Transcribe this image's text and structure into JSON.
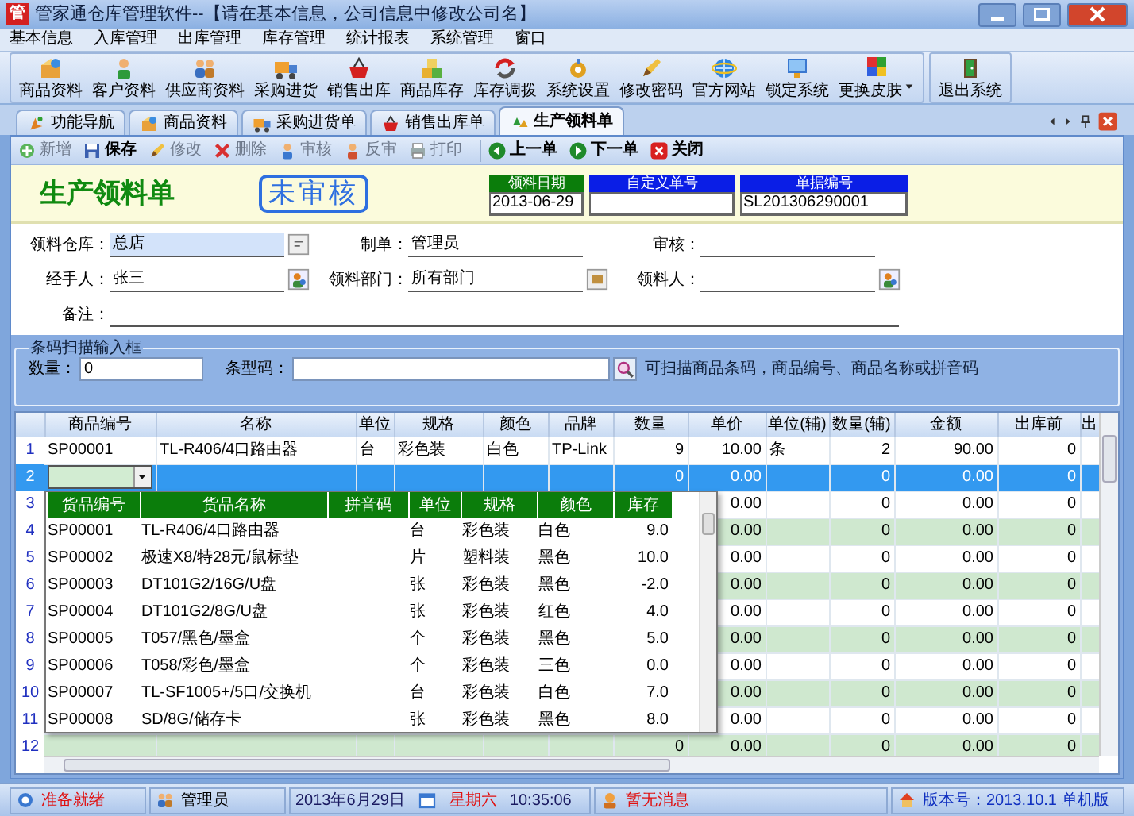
{
  "window": {
    "app_logo": "管",
    "title": "管家通仓库管理软件--【请在基本信息，公司信息中修改公司名】"
  },
  "menu": [
    "基本信息",
    "入库管理",
    "出库管理",
    "库存管理",
    "统计报表",
    "系统管理",
    "窗口"
  ],
  "toolbar": {
    "items": [
      {
        "label": "商品资料",
        "dropdown": false
      },
      {
        "label": "客户资料",
        "dropdown": false
      },
      {
        "label": "供应商资料",
        "dropdown": false
      },
      {
        "label": "采购进货",
        "dropdown": false
      },
      {
        "label": "销售出库",
        "dropdown": false
      },
      {
        "label": "商品库存",
        "dropdown": false
      },
      {
        "label": "库存调拨",
        "dropdown": false
      },
      {
        "label": "系统设置",
        "dropdown": false
      },
      {
        "label": "修改密码",
        "dropdown": false
      },
      {
        "label": "官方网站",
        "dropdown": false
      },
      {
        "label": "锁定系统",
        "dropdown": false
      },
      {
        "label": "更换皮肤",
        "dropdown": true
      }
    ],
    "end_items": [
      {
        "label": "退出系统"
      }
    ]
  },
  "tabs": [
    {
      "label": "功能导航",
      "selected": false
    },
    {
      "label": "商品资料",
      "selected": false
    },
    {
      "label": "采购进货单",
      "selected": false
    },
    {
      "label": "销售出库单",
      "selected": false
    },
    {
      "label": "生产领料单",
      "selected": true
    }
  ],
  "actions": [
    [
      {
        "label": "新增",
        "disabled": true
      },
      {
        "label": "保存",
        "disabled": false
      },
      {
        "label": "修改",
        "disabled": true
      },
      {
        "label": "删除",
        "disabled": true
      },
      {
        "label": "审核",
        "disabled": true
      },
      {
        "label": "反审",
        "disabled": true
      },
      {
        "label": "打印",
        "disabled": true
      }
    ],
    [
      {
        "label": "上一单",
        "disabled": false
      },
      {
        "label": "下一单",
        "disabled": false
      },
      {
        "label": "关闭",
        "disabled": false
      }
    ]
  ],
  "form": {
    "title": "生产领料单",
    "status": "未审核",
    "header_fields": [
      {
        "label": "领料日期",
        "value": "2013-06-29",
        "color": "#0b7d0b"
      },
      {
        "label": "自定义单号",
        "color": "#0a1ee6"
      },
      {
        "label": "单据编号",
        "value": "SL201306290001",
        "color": "#0a1ee6"
      }
    ],
    "fields": [
      {
        "label": "领料仓库：",
        "value": "总店",
        "focused": true,
        "kind": "list"
      },
      {
        "label": "制单：",
        "value": "管理员",
        "focused": false,
        "kind": "plain"
      },
      {
        "label": "审核：",
        "focused": false,
        "kind": "plain"
      },
      {
        "label": "经手人：",
        "value": "张三",
        "focused": false,
        "kind": "person"
      },
      {
        "label": "领料部门：",
        "value": "所有部门",
        "focused": false,
        "kind": "folder"
      },
      {
        "label": "领料人：",
        "focused": false,
        "kind": "person"
      }
    ],
    "remark": {
      "label": "备注："
    }
  },
  "barcode": {
    "title": "条码扫描输入框",
    "quantity": {
      "label": "数量：",
      "value": "0"
    },
    "code": {
      "label": "条型码："
    },
    "hint": "可扫描商品条码，商品编号、商品名称或拼音码"
  },
  "grid": {
    "columns": [
      "商品编号",
      "名称",
      "单位",
      "规格",
      "颜色",
      "品牌",
      "数量",
      "单价",
      "单位(辅)",
      "数量(辅)",
      "金额",
      "出库前",
      "出"
    ],
    "rows": [
      {
        "number": "1",
        "selected": false,
        "editing": false,
        "cells": [
          "SP00001",
          "TL-R406/4口路由器",
          "台",
          "彩色装",
          "白色",
          "TP-Link",
          "9",
          "10.00",
          "条",
          "2",
          "90.00",
          "0",
          null
        ]
      },
      {
        "number": "2",
        "selected": true,
        "editing": true,
        "cells": [
          null,
          null,
          null,
          null,
          null,
          null,
          "0",
          "0.00",
          null,
          "0",
          "0.00",
          "0",
          null
        ]
      },
      {
        "number": "3",
        "selected": false,
        "editing": false,
        "cells": [
          null,
          null,
          null,
          null,
          null,
          null,
          null,
          "0.00",
          null,
          "0",
          "0.00",
          "0",
          null
        ]
      },
      {
        "number": "4",
        "selected": false,
        "editing": false,
        "cells": [
          null,
          null,
          null,
          null,
          null,
          null,
          null,
          "0.00",
          null,
          "0",
          "0.00",
          "0",
          null
        ]
      },
      {
        "number": "5",
        "selected": false,
        "editing": false,
        "cells": [
          null,
          null,
          null,
          null,
          null,
          null,
          null,
          "0.00",
          null,
          "0",
          "0.00",
          "0",
          null
        ]
      },
      {
        "number": "6",
        "selected": false,
        "editing": false,
        "cells": [
          null,
          null,
          null,
          null,
          null,
          null,
          null,
          "0.00",
          null,
          "0",
          "0.00",
          "0",
          null
        ]
      },
      {
        "number": "7",
        "selected": false,
        "editing": false,
        "cells": [
          null,
          null,
          null,
          null,
          null,
          null,
          null,
          "0.00",
          null,
          "0",
          "0.00",
          "0",
          null
        ]
      },
      {
        "number": "8",
        "selected": false,
        "editing": false,
        "cells": [
          null,
          null,
          null,
          null,
          null,
          null,
          null,
          "0.00",
          null,
          "0",
          "0.00",
          "0",
          null
        ]
      },
      {
        "number": "9",
        "selected": false,
        "editing": false,
        "cells": [
          null,
          null,
          null,
          null,
          null,
          null,
          null,
          "0.00",
          null,
          "0",
          "0.00",
          "0",
          null
        ]
      },
      {
        "number": "10",
        "selected": false,
        "editing": false,
        "cells": [
          null,
          null,
          null,
          null,
          null,
          null,
          null,
          "0.00",
          null,
          "0",
          "0.00",
          "0",
          null
        ]
      },
      {
        "number": "11",
        "selected": false,
        "editing": false,
        "cells": [
          null,
          null,
          null,
          null,
          null,
          null,
          null,
          "0.00",
          null,
          "0",
          "0.00",
          "0",
          null
        ]
      },
      {
        "number": "12",
        "selected": false,
        "editing": false,
        "cells": [
          null,
          null,
          null,
          null,
          null,
          null,
          "0",
          "0.00",
          null,
          "0",
          "0.00",
          "0",
          null
        ]
      }
    ]
  },
  "dropdown": {
    "columns": [
      "货品编号",
      "货品名称",
      "拼音码",
      "单位",
      "规格",
      "颜色",
      "库存"
    ],
    "rows": [
      [
        "SP00001",
        "TL-R406/4口路由器",
        null,
        "台",
        "彩色装",
        "白色",
        "9.0"
      ],
      [
        "SP00002",
        "极速X8/特28元/鼠标垫",
        null,
        "片",
        "塑料装",
        "黑色",
        "10.0"
      ],
      [
        "SP00003",
        "DT101G2/16G/U盘",
        null,
        "张",
        "彩色装",
        "黑色",
        "-2.0"
      ],
      [
        "SP00004",
        "DT101G2/8G/U盘",
        null,
        "张",
        "彩色装",
        "红色",
        "4.0"
      ],
      [
        "SP00005",
        "T057/黑色/墨盒",
        null,
        "个",
        "彩色装",
        "黑色",
        "5.0"
      ],
      [
        "SP00006",
        "T058/彩色/墨盒",
        null,
        "个",
        "彩色装",
        "三色",
        "0.0"
      ],
      [
        "SP00007",
        "TL-SF1005+/5口/交换机",
        null,
        "台",
        "彩色装",
        "白色",
        "7.0"
      ],
      [
        "SP00008",
        "SD/8G/储存卡",
        null,
        "张",
        "彩色装",
        "黑色",
        "8.0"
      ]
    ]
  },
  "status_bar": [
    {
      "text": "准备就绪",
      "color": "#e01010"
    },
    {
      "text": "管理员",
      "color": "#000000"
    },
    {
      "text": "2013年6月29日",
      "color": "#1a1a60"
    },
    {
      "text": "星期六",
      "color": "#e01010"
    },
    {
      "text": "10:35:06",
      "color": "#1a1a60"
    },
    {
      "text": "暂无消息",
      "color": "#e01010"
    },
    {
      "text": "版本号：2013.10.1 单机版",
      "color": "#1030c0"
    }
  ]
}
